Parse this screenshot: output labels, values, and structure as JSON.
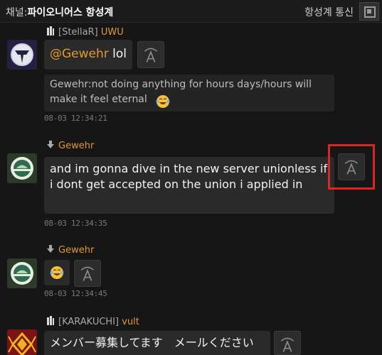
{
  "header": {
    "channel_prefix": "채널:",
    "channel_name": "파이오니어스 항성계",
    "comm_label": "항성계 통신"
  },
  "messages": [
    {
      "tag": "[StellaR]",
      "name": "UWU",
      "mention": "@Gewehr",
      "text": " lol",
      "quote": "Gewehr:not doing anything for hours days/hours will make it feel eternal",
      "time": "08-03 12:34:21"
    },
    {
      "name": "Gewehr",
      "text": "and im gonna dive in the new server unionless if i dont get accepted on the union i applied in",
      "time": "08-03 12:34:35"
    },
    {
      "name": "Gewehr",
      "text": "",
      "time": "08-03 12:34:45"
    },
    {
      "tag": "[KARAKUCHI]",
      "name": "vult",
      "text": "メンバー募集してます　メールください"
    }
  ],
  "icons": {
    "translate": "translate-icon",
    "emoji": "tears-of-joy-emoji",
    "popout": "popout-icon"
  },
  "colors": {
    "name": "#e19a2a",
    "bubble": "#2a2a2a",
    "highlight": "#e02424"
  }
}
